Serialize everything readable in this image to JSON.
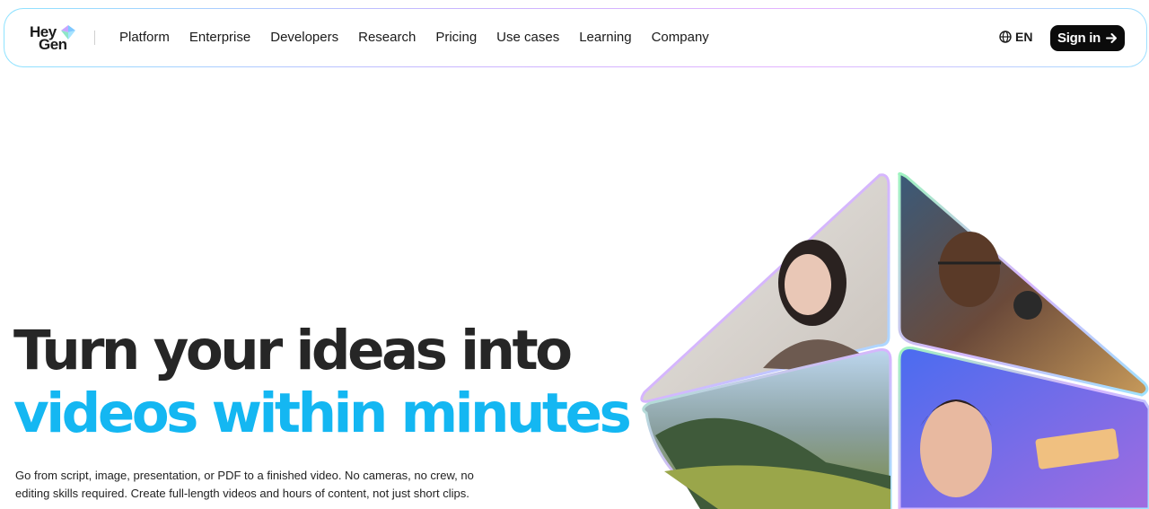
{
  "brand": {
    "logo_line1": "Hey",
    "logo_line2": "Gen",
    "logo_colors": [
      "#8de6c8",
      "#c7a6ff",
      "#7ec8ff"
    ]
  },
  "nav": {
    "items": [
      {
        "label": "Platform"
      },
      {
        "label": "Enterprise"
      },
      {
        "label": "Developers"
      },
      {
        "label": "Research"
      },
      {
        "label": "Pricing"
      },
      {
        "label": "Use cases"
      },
      {
        "label": "Learning"
      },
      {
        "label": "Company"
      }
    ],
    "language": "EN",
    "language_icon": "globe-icon",
    "signin_label": "Sign in",
    "signin_icon": "arrow-right-icon"
  },
  "hero": {
    "headline_line1": "Turn your ideas into",
    "headline_line2": "videos within minutes",
    "headline_accent_color": "#14b7f2",
    "description": "Go from script, image, presentation, or PDF to a finished video. No cameras, no crew, no editing skills required. Create full-length videos and hours of content, not just short clips."
  },
  "visual": {
    "panels": [
      {
        "name": "avatar-woman"
      },
      {
        "name": "avatar-man-glasses"
      },
      {
        "name": "landscape-scene"
      },
      {
        "name": "avatar-young-man"
      }
    ]
  }
}
